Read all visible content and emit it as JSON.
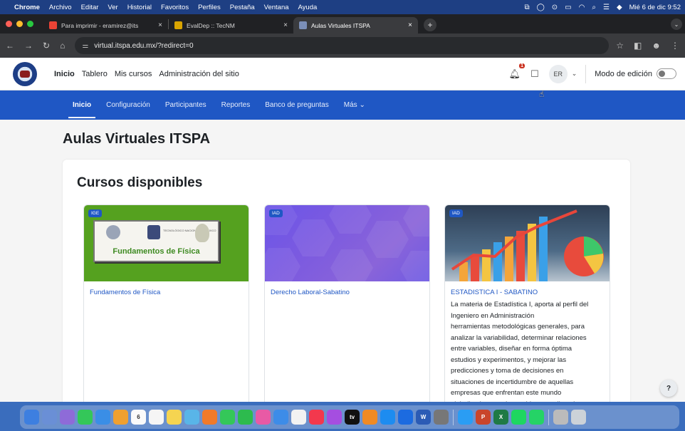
{
  "menubar": {
    "app": "Chrome",
    "menus": [
      "Archivo",
      "Editar",
      "Ver",
      "Historial",
      "Favoritos",
      "Perfiles",
      "Pestaña",
      "Ventana",
      "Ayuda"
    ],
    "clock": "Mié 6 de dic  9:52"
  },
  "tabs": [
    {
      "label": "Para imprimir - eramirez@its",
      "icon": "gmail-icon",
      "color": "#ea4335"
    },
    {
      "label": "EvalDep :: TecNM",
      "icon": "tecnm-icon",
      "color": "#d9a400"
    },
    {
      "label": "Aulas Virtuales ITSPA",
      "icon": "itspa-icon",
      "color": "#7b8fb8"
    }
  ],
  "url": "virtual.itspa.edu.mx/?redirect=0",
  "moodle": {
    "primary_nav": [
      "Inicio",
      "Tablero",
      "Mis cursos",
      "Administración del sitio"
    ],
    "notif_count": "1",
    "user_initials": "ER",
    "edit_mode_label": "Modo de edición"
  },
  "secondary_nav": [
    "Inicio",
    "Configuración",
    "Participantes",
    "Reportes",
    "Banco de preguntas",
    "Más"
  ],
  "page_title": "Aulas Virtuales ITSPA",
  "section_title": "Cursos disponibles",
  "courses": [
    {
      "category": "IGE",
      "name": "Fundamentos de Física",
      "banner_text": "Fundamentos de Física",
      "banner_small": "TECNOLÓGICO NACIONAL DE MÉXICO",
      "summary": ""
    },
    {
      "category": "IAD",
      "name": "Derecho Laboral-Sabatino",
      "summary": ""
    },
    {
      "category": "IAD",
      "name": "ESTADISTICA I - SABATINO",
      "summary_lines": [
        "La materia de Estadística I, aporta al perfil del",
        "Ingeniero en Administración",
        "herramientas metodológicas generales, para",
        "analizar la variabilidad, determinar relaciones",
        "entre variables, diseñar en forma óptima",
        "estudios y experimentos, y mejorar las",
        "predicciones y toma de decisiones en",
        "situaciones de incertidumbre de aquellas",
        "empresas que enfrentan este mundo",
        "globalizado; resuelve problemas aplicando"
      ]
    }
  ],
  "help_label": "?",
  "colors": {
    "brand_blue": "#1f57c4",
    "menubar": "#1e3f83",
    "fisica_green": "#55a11f"
  }
}
